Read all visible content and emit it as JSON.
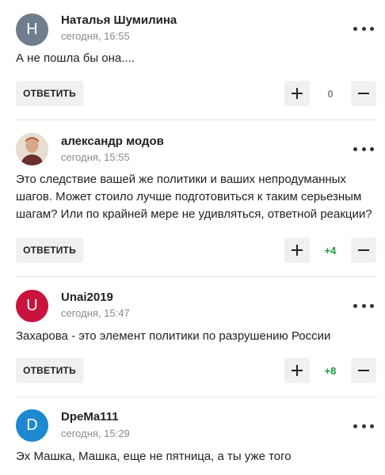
{
  "comments": [
    {
      "avatar_letter": "H",
      "avatar_color": "#6f7d8c",
      "author": "Наталья Шумилина",
      "time": "сегодня, 16:55",
      "text": "А не пошла бы она....",
      "reply_label": "ОТВЕТИТЬ",
      "score": "0",
      "score_color": "#888888"
    },
    {
      "avatar_letter": "",
      "avatar_color": "#c9a68a",
      "author": "александр модов",
      "time": "сегодня, 15:55",
      "text": "Это следствие вашей же политики и ваших непродуманных шагов. Может стоило лучше подготовиться к таким серьезным шагам? Или по крайней мере не удивляться, ответной реакции?",
      "reply_label": "ОТВЕТИТЬ",
      "score": "+4",
      "score_color": "#1a9a3a"
    },
    {
      "avatar_letter": "U",
      "avatar_color": "#c8143c",
      "author": "Unai2019",
      "time": "сегодня, 15:47",
      "text": "Захарова - это элемент политики по разрушению России",
      "reply_label": "ОТВЕТИТЬ",
      "score": "+8",
      "score_color": "#1a9a3a"
    },
    {
      "avatar_letter": "D",
      "avatar_color": "#1e88d0",
      "author": "DpeMa111",
      "time": "сегодня, 15:29",
      "text": "Эх Машка, Машка, еще не пятница, а ты уже того"
    }
  ]
}
